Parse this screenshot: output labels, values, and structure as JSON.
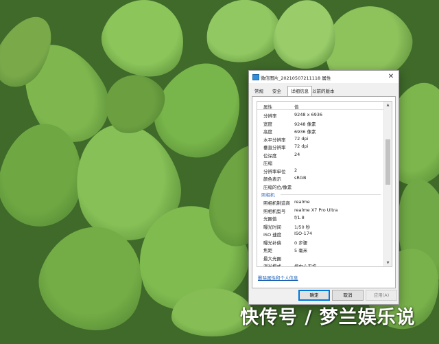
{
  "window": {
    "title": "微信图片_20210507211118 属性",
    "close_glyph": "✕"
  },
  "tabs": [
    "常规",
    "安全",
    "详细信息",
    "以前的版本"
  ],
  "list": {
    "header_property": "属性",
    "header_value": "值",
    "rows_top": [
      {
        "k": "分辨率",
        "v": "9248 x 6936"
      },
      {
        "k": "宽度",
        "v": "9248 像素"
      },
      {
        "k": "高度",
        "v": "6936 像素"
      },
      {
        "k": "水平分辨率",
        "v": "72 dpi"
      },
      {
        "k": "垂直分辨率",
        "v": "72 dpi"
      },
      {
        "k": "位深度",
        "v": "24"
      },
      {
        "k": "压缩",
        "v": ""
      },
      {
        "k": "分辨率单位",
        "v": "2"
      },
      {
        "k": "颜色表示",
        "v": "sRGB"
      },
      {
        "k": "压缩的位/像素",
        "v": ""
      }
    ],
    "section_camera": "照相机",
    "rows_camera": [
      {
        "k": "照相机制造商",
        "v": "realme"
      },
      {
        "k": "照相机型号",
        "v": "realme X7 Pro Ultra"
      },
      {
        "k": "光圈值",
        "v": "f/1.8"
      },
      {
        "k": "曝光时间",
        "v": "1/50 秒"
      },
      {
        "k": "ISO 速度",
        "v": "ISO-174"
      },
      {
        "k": "曝光补偿",
        "v": "0 步骤"
      },
      {
        "k": "焦距",
        "v": "5 毫米"
      },
      {
        "k": "最大光圈",
        "v": ""
      },
      {
        "k": "测光模式",
        "v": "偏中心平均"
      }
    ]
  },
  "remove_link": "删除属性和个人信息",
  "buttons": {
    "ok": "确定",
    "cancel": "取消",
    "apply": "应用(A)"
  },
  "watermark": "快传号 / 梦兰娱乐说"
}
